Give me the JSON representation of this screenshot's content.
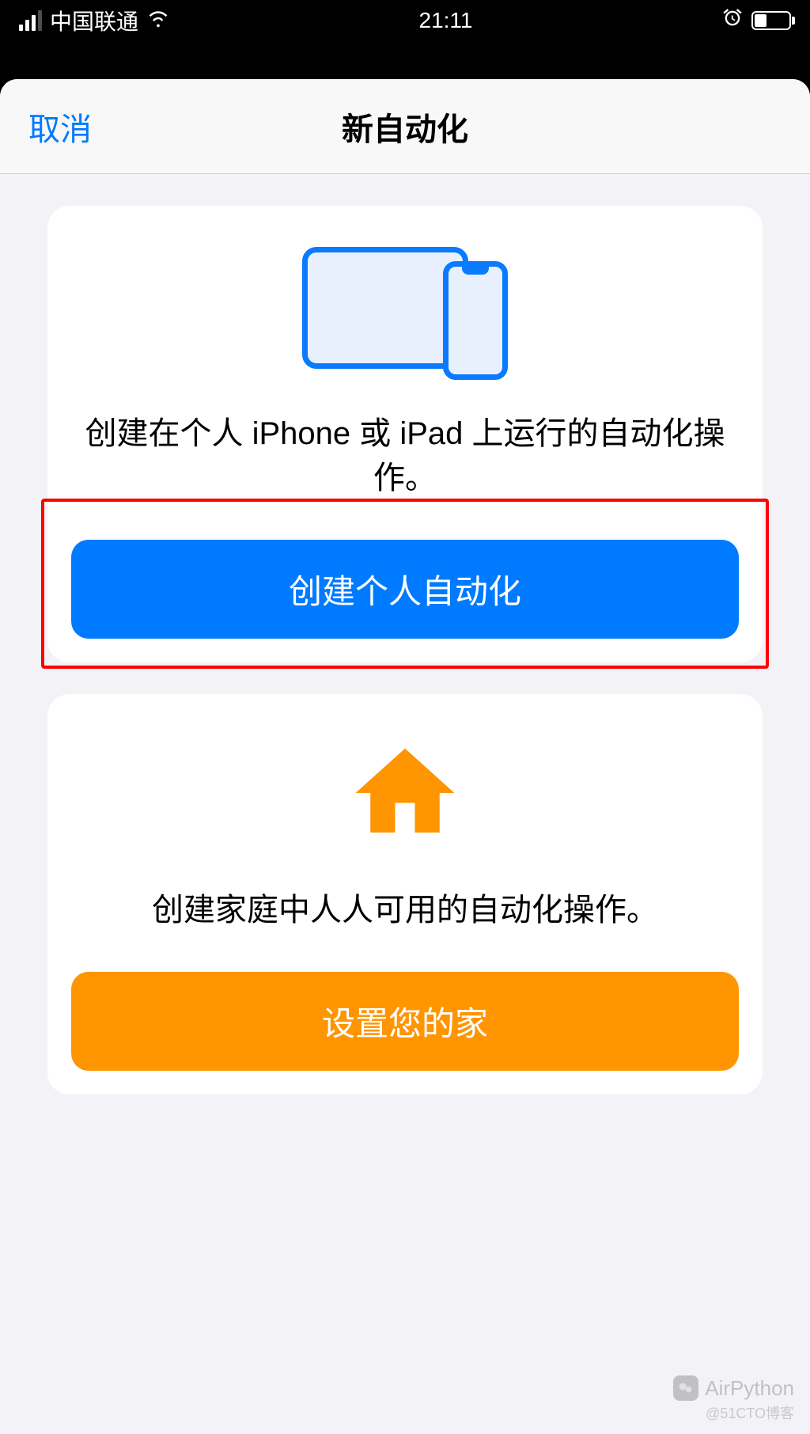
{
  "statusBar": {
    "carrier": "中国联通",
    "time": "21:11"
  },
  "navBar": {
    "cancel": "取消",
    "title": "新自动化"
  },
  "cards": {
    "personal": {
      "description": "创建在个人 iPhone 或 iPad 上运行的自动化操作。",
      "buttonLabel": "创建个人自动化"
    },
    "home": {
      "description": "创建家庭中人人可用的自动化操作。",
      "buttonLabel": "设置您的家"
    }
  },
  "watermark": {
    "name": "AirPython",
    "sub": "@51CTO博客"
  },
  "colors": {
    "primary": "#007aff",
    "orange": "#ff9500",
    "highlight": "#ff0000"
  }
}
